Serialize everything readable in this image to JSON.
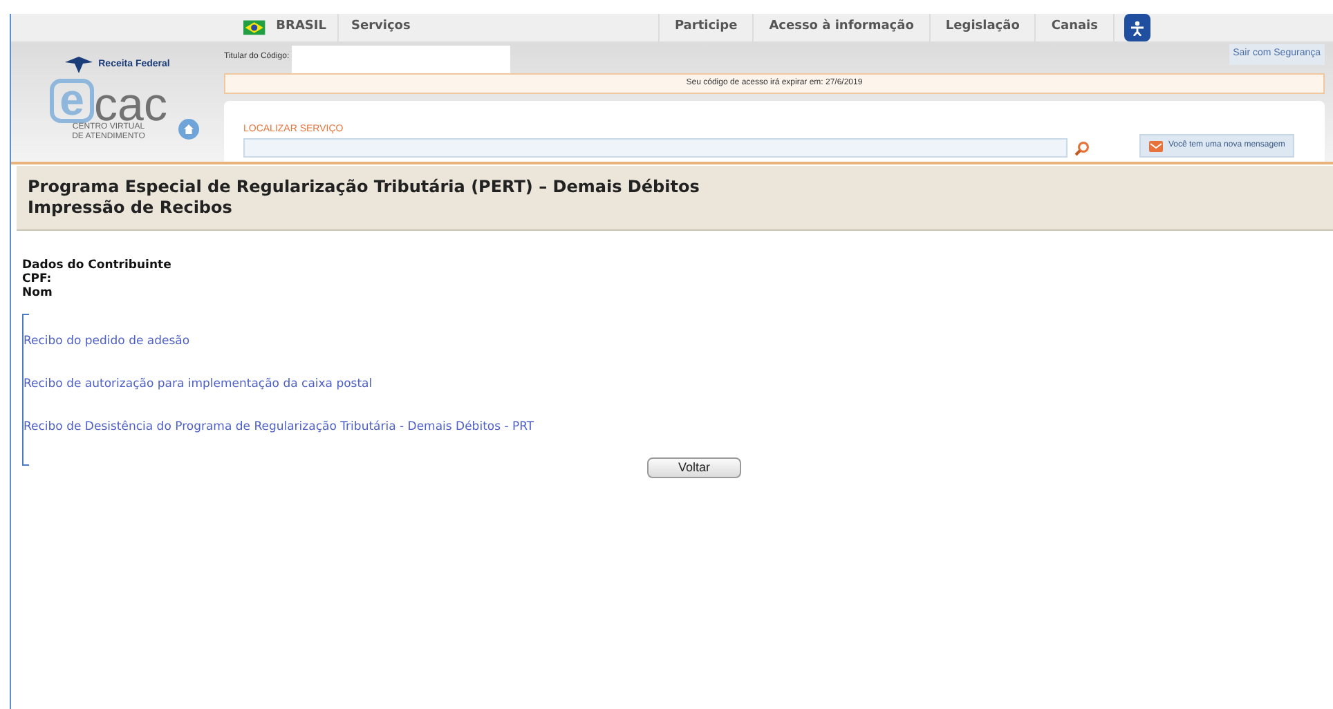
{
  "top_nav": {
    "country": "BRASIL",
    "left_items": [
      "Serviços"
    ],
    "right_items": [
      "Participe",
      "Acesso à informação",
      "Legislação",
      "Canais"
    ]
  },
  "header": {
    "agency": "Receita Federal",
    "logo_mark": "e",
    "logo_name": "cac",
    "logo_sub": [
      "CENTRO VIRTUAL",
      "DE ATENDIMENTO"
    ],
    "holder_label": "Titular do Código:",
    "logout": "Sair com Segurança",
    "expiry_notice": "Seu código de acesso irá expirar em: 27/6/2019",
    "search": {
      "label": "LOCALIZAR SERVIÇO"
    },
    "message_button": "Você tem uma nova mensagem"
  },
  "page": {
    "title": "Programa Especial de Regularização Tributária (PERT) – Demais Débitos",
    "subtitle": "Impressão de Recibos"
  },
  "taxpayer": {
    "heading": "Dados do Contribuinte",
    "lines": [
      "CPF:",
      "Nom"
    ]
  },
  "links": [
    "Recibo do pedido de adesão",
    "Recibo de autorização para implementação da caixa postal",
    "Recibo de Desistência do Programa de Regularização Tributária - Demais Débitos - PRT"
  ],
  "back_button": "Voltar"
}
